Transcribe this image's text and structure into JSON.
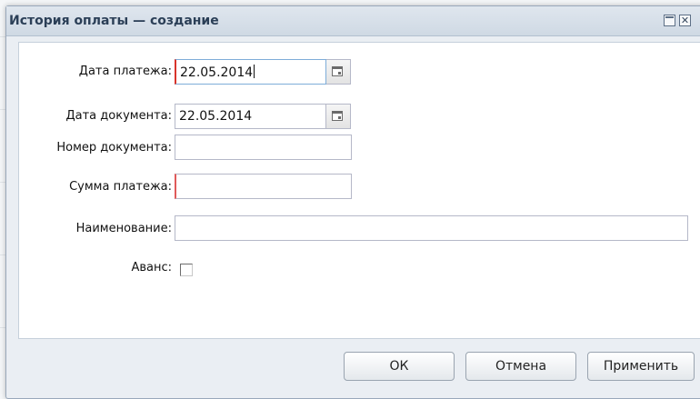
{
  "dialog": {
    "title": "История оплаты — создание"
  },
  "form": {
    "payment_date": {
      "label": "Дата платежа:",
      "value": "22.05.2014"
    },
    "document_date": {
      "label": "Дата документа:",
      "value": "22.05.2014"
    },
    "document_number": {
      "label": "Номер документа:",
      "value": ""
    },
    "payment_sum": {
      "label": "Сумма платежа:",
      "value": ""
    },
    "name": {
      "label": "Наименование:",
      "value": ""
    },
    "advance": {
      "label": "Аванс:",
      "checked": false
    }
  },
  "buttons": {
    "ok": "ОК",
    "cancel": "Отмена",
    "apply": "Применить"
  },
  "icons": {
    "maximize": "maximize-icon",
    "close": "close-icon",
    "calendar": "calendar-icon"
  },
  "colors": {
    "title_text": "#2b3f57",
    "required_marker": "#e05a5a",
    "dialog_bg": "#eaeef3"
  }
}
